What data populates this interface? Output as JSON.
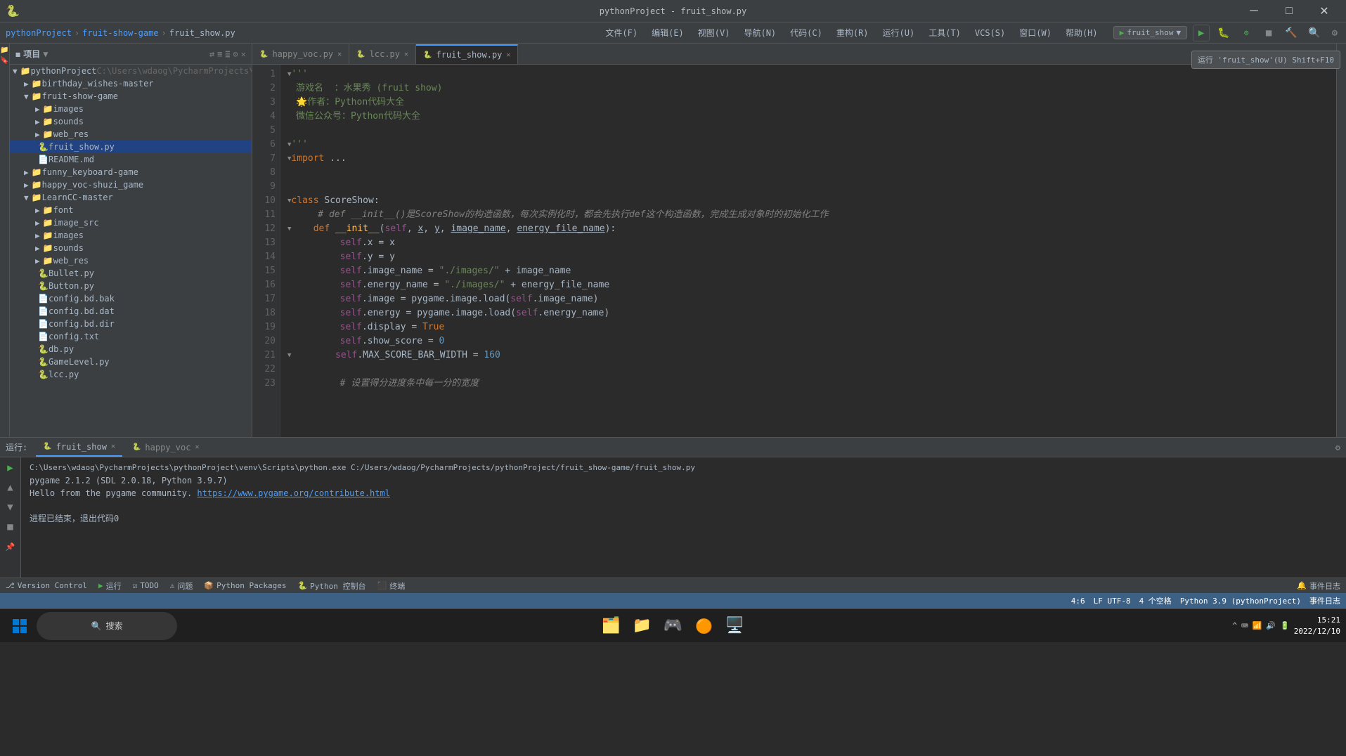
{
  "titleBar": {
    "title": "pythonProject - fruit_show.py",
    "minimizeLabel": "─",
    "maximizeLabel": "□",
    "closeLabel": "✕"
  },
  "navBar": {
    "appName": "pythonProject",
    "breadcrumb": [
      "pythonProject",
      "fruit-show-game",
      "fruit_show.py"
    ],
    "breadcrumbSeps": [
      ">",
      ">"
    ],
    "menus": [
      "文件(F)",
      "编辑(E)",
      "视图(V)",
      "导航(N)",
      "代码(C)",
      "重构(R)",
      "运行(U)",
      "工具(T)",
      "VCS(S)",
      "窗口(W)",
      "帮助(H)"
    ],
    "runConfig": "fruit_show",
    "tooltipText": "运行 'fruit_show'(U) Shift+F10"
  },
  "fileTree": {
    "title": "项目",
    "items": [
      {
        "id": "pythonProject",
        "label": "pythonProject",
        "type": "root",
        "icon": "▶",
        "path": "C:\\Users\\wdaog\\PycharmProjects\\",
        "indent": 0
      },
      {
        "id": "birthday_wishes-master",
        "label": "birthday_wishes-master",
        "type": "folder",
        "indent": 1
      },
      {
        "id": "fruit-show-game",
        "label": "fruit-show-game",
        "type": "folder",
        "expanded": true,
        "indent": 1
      },
      {
        "id": "images",
        "label": "images",
        "type": "folder",
        "indent": 2
      },
      {
        "id": "sounds1",
        "label": "sounds",
        "type": "folder",
        "indent": 2
      },
      {
        "id": "web_res1",
        "label": "web_res",
        "type": "folder",
        "indent": 2
      },
      {
        "id": "fruit_show",
        "label": "fruit_show.py",
        "type": "py",
        "selected": true,
        "indent": 2
      },
      {
        "id": "README",
        "label": "README.md",
        "type": "md",
        "indent": 2
      },
      {
        "id": "funny_keyboard-game",
        "label": "funny_keyboard-game",
        "type": "folder",
        "indent": 1
      },
      {
        "id": "happy_voc-shuzi_game",
        "label": "happy_voc-shuzi_game",
        "type": "folder",
        "indent": 1
      },
      {
        "id": "LearnCC-master",
        "label": "LearnCC-master",
        "type": "folder",
        "expanded": true,
        "indent": 1
      },
      {
        "id": "font",
        "label": "font",
        "type": "folder",
        "indent": 2
      },
      {
        "id": "image_src",
        "label": "image_src",
        "type": "folder",
        "indent": 2
      },
      {
        "id": "images2",
        "label": "images",
        "type": "folder",
        "indent": 2
      },
      {
        "id": "sounds2",
        "label": "sounds",
        "type": "folder",
        "indent": 2
      },
      {
        "id": "web_res2",
        "label": "web_res",
        "type": "folder",
        "indent": 2
      },
      {
        "id": "Bullet",
        "label": "Bullet.py",
        "type": "py",
        "indent": 2
      },
      {
        "id": "Button",
        "label": "Button.py",
        "type": "py",
        "indent": 2
      },
      {
        "id": "config_bd_bak",
        "label": "config.bd.bak",
        "type": "file",
        "indent": 2
      },
      {
        "id": "config_bd_dat",
        "label": "config.bd.dat",
        "type": "file",
        "indent": 2
      },
      {
        "id": "config_bd_dir",
        "label": "config.bd.dir",
        "type": "file",
        "indent": 2
      },
      {
        "id": "config_txt",
        "label": "config.txt",
        "type": "file",
        "indent": 2
      },
      {
        "id": "db",
        "label": "db.py",
        "type": "py",
        "indent": 2
      },
      {
        "id": "GameLevel",
        "label": "GameLevel.py",
        "type": "py",
        "indent": 2
      },
      {
        "id": "lcc",
        "label": "lcc.py",
        "type": "py",
        "indent": 2
      }
    ]
  },
  "tabs": [
    {
      "id": "happy_voc",
      "label": "happy_voc.py",
      "icon": "🐍",
      "active": false,
      "modified": false
    },
    {
      "id": "lcc",
      "label": "lcc.py",
      "icon": "🐍",
      "active": false,
      "modified": false
    },
    {
      "id": "fruit_show",
      "label": "fruit_show.py",
      "icon": "🐍",
      "active": true,
      "modified": false
    }
  ],
  "codeLines": [
    {
      "num": 1,
      "content": "'''",
      "type": "str"
    },
    {
      "num": 2,
      "content": "游戏名  ：水果秀 (fruit show)",
      "type": "comment"
    },
    {
      "num": 3,
      "content": "🌟作者：Python代码大全",
      "type": "comment"
    },
    {
      "num": 4,
      "content": "微信公众号：Python代码大全",
      "type": "comment"
    },
    {
      "num": 5,
      "content": "",
      "type": "normal"
    },
    {
      "num": 6,
      "content": "'''",
      "type": "str"
    },
    {
      "num": 7,
      "content": "import ...",
      "type": "kw"
    },
    {
      "num": 8,
      "content": "",
      "type": "normal"
    },
    {
      "num": 9,
      "content": "",
      "type": "normal"
    },
    {
      "num": 10,
      "content": "class ScoreShow:",
      "type": "cls"
    },
    {
      "num": 11,
      "content": "    # def __init__()是ScoreShow的构造函数，每次实例化时，都会先执行def这个构造函数，完成生成对象时的初始化工作",
      "type": "comment"
    },
    {
      "num": 12,
      "content": "    def __init__(self, x, y, image_name, energy_file_name):",
      "type": "func"
    },
    {
      "num": 13,
      "content": "        self.x = x",
      "type": "normal"
    },
    {
      "num": 14,
      "content": "        self.y = y",
      "type": "normal"
    },
    {
      "num": 15,
      "content": "        self.image_name = \"./images/\" + image_name",
      "type": "normal"
    },
    {
      "num": 16,
      "content": "        self.energy_name = \"./images/\" + energy_file_name",
      "type": "normal"
    },
    {
      "num": 17,
      "content": "        self.image = pygame.image.load(self.image_name)",
      "type": "normal"
    },
    {
      "num": 18,
      "content": "        self.energy = pygame.image.load(self.energy_name)",
      "type": "normal"
    },
    {
      "num": 19,
      "content": "        self.display = True",
      "type": "normal"
    },
    {
      "num": 20,
      "content": "        self.show_score = 0",
      "type": "normal"
    },
    {
      "num": 21,
      "content": "        self.MAX_SCORE_BAR_WIDTH = 160",
      "type": "normal"
    },
    {
      "num": 22,
      "content": "",
      "type": "normal"
    },
    {
      "num": 23,
      "content": "        # 设置得分进度条中每一分的宽度",
      "type": "comment"
    }
  ],
  "runPanel": {
    "tabs": [
      {
        "id": "fruit_show_run",
        "label": "fruit_show",
        "active": true
      },
      {
        "id": "happy_voc_run",
        "label": "happy_voc",
        "active": false
      }
    ],
    "output": [
      "C:\\Users\\wdaog\\PycharmProjects\\pythonProject\\venv\\Scripts\\python.exe C:/Users/wdaog/PycharmProjects/pythonProject/fruit_show-game/fruit_show.py",
      "pygame 2.1.2 (SDL 2.0.18, Python 3.9.7)",
      "Hello from the pygame community. https://www.pygame.org/contribute.html",
      "",
      "进程已结束，退出代码0"
    ],
    "link": "https://www.pygame.org/contribute.html"
  },
  "bottomToolbar": {
    "items": [
      "Version Control",
      "运行",
      "TODO",
      "问题",
      "Python Packages",
      "Python 控制台",
      "终端"
    ]
  },
  "statusBar": {
    "left": "事件日志",
    "position": "4:6",
    "encoding": "LF  UTF-8",
    "indent": "4 个空格",
    "python": "Python 3.9 (pythonProject)"
  },
  "taskbar": {
    "startIcon": "⊞",
    "searchLabel": "搜索",
    "systemIcons": [
      "🗂️",
      "📁",
      "🎮",
      "🌐",
      "🖥️"
    ],
    "trayIcons": [
      "^",
      "⌨",
      "📶",
      "🔊",
      "🔋"
    ],
    "time": "15:21",
    "date": "2022/12/10"
  }
}
